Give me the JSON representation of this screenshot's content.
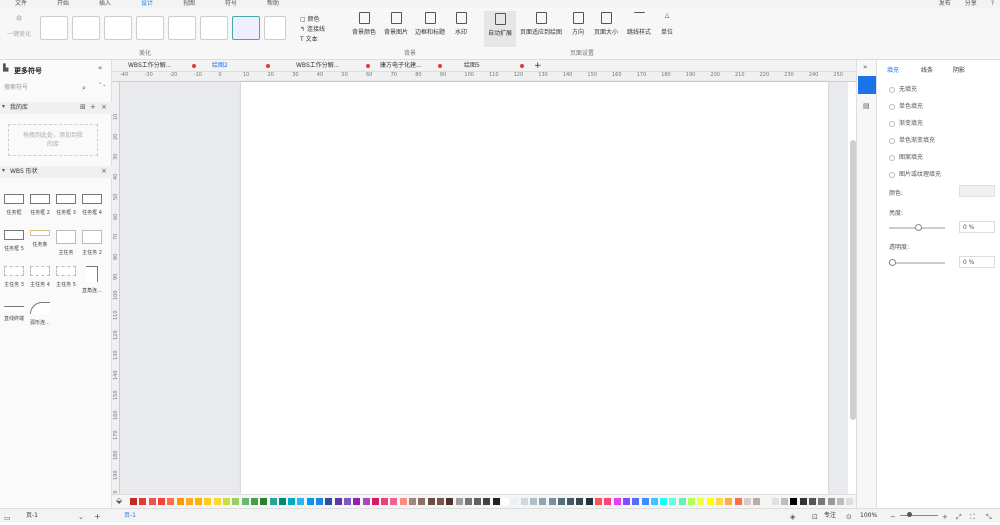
{
  "menu": {
    "tabs": [
      "文件",
      "开始",
      "插入",
      "设计",
      "视图",
      "符号",
      "帮助"
    ],
    "active_index": 3,
    "right": [
      "发布",
      "分享",
      "?"
    ]
  },
  "ribbon": {
    "beautify_label": "一键美化",
    "group_beautify": "美化",
    "theme_options": [
      "颜色",
      "连接线",
      "文本"
    ],
    "group_background": "背景",
    "bg_buttons": [
      "背景颜色",
      "背景图片",
      "边框和标题",
      "水印"
    ],
    "group_page": "页面设置",
    "page_buttons": [
      "自动扩展",
      "页面适应到绘图",
      "方向",
      "页面大小",
      "跳线样式",
      "单位"
    ]
  },
  "left_panel": {
    "title": "更多符号",
    "search_placeholder": "搜索符号",
    "my_library": "我的库",
    "drop_hint": "拖拽到此处，添加到我的库",
    "wbs_section": "WBS 形状",
    "shapes": [
      "任务框",
      "任务框 2",
      "任务框 3",
      "任务框 4",
      "任务框 5",
      "任务条",
      "主任务",
      "主任务 2",
      "主任务 3",
      "主任务 4",
      "主任务 5",
      "直角连…",
      "直线终端",
      "弧形连…"
    ]
  },
  "doc_tabs": [
    "WBS工作分解...",
    "绘图2",
    "WBS工作分解...",
    "康方电子化建...",
    "绘图5"
  ],
  "active_doc_tab": 1,
  "ruler_top": [
    "-40",
    "-30",
    "-20",
    "-10",
    "0",
    "10",
    "20",
    "30",
    "40",
    "50",
    "60",
    "70",
    "80",
    "90",
    "100",
    "110",
    "120",
    "130",
    "140",
    "150",
    "160",
    "170",
    "180",
    "190",
    "200",
    "210",
    "220",
    "230",
    "240",
    "250"
  ],
  "ruler_left": [
    "10",
    "20",
    "30",
    "40",
    "50",
    "60",
    "70",
    "80",
    "90",
    "100",
    "110",
    "120",
    "130",
    "140",
    "150",
    "160",
    "170",
    "180",
    "190",
    "200"
  ],
  "right_panel": {
    "tabs": [
      "填充",
      "线条",
      "阴影"
    ],
    "active_tab": 0,
    "fill_options": [
      "无填充",
      "单色填充",
      "渐变填充",
      "单色渐变填充",
      "图案填充",
      "图片或纹理填充"
    ],
    "color_label": "颜色:",
    "brightness_label": "亮度:",
    "brightness_value": "0 %",
    "transparency_label": "透明度:",
    "transparency_value": "0 %"
  },
  "status": {
    "page_left": "页-1",
    "page_tab": "页-1",
    "focus": "专注",
    "zoom": "100%"
  },
  "colors": {
    "accent": "#1a73e8",
    "red_dot": "#e53935"
  },
  "palette": [
    "#c62828",
    "#e53935",
    "#ef5350",
    "#f44336",
    "#ff7043",
    "#ff9800",
    "#ffa726",
    "#ffb300",
    "#ffca28",
    "#fdd835",
    "#cddc39",
    "#9ccc65",
    "#66bb6a",
    "#43a047",
    "#2e7d32",
    "#26a69a",
    "#00897b",
    "#00acc1",
    "#29b6f6",
    "#039be5",
    "#1e88e5",
    "#3949ab",
    "#5e35b1",
    "#7e57c2",
    "#8e24aa",
    "#ab47bc",
    "#d81b60",
    "#ec407a",
    "#f06292",
    "#ff8a80",
    "#a1887f",
    "#8d6e63",
    "#6d4c41",
    "#795548",
    "#4e342e",
    "#9e9e9e",
    "#757575",
    "#616161",
    "#424242",
    "#212121",
    "#ffffff",
    "#eceff1",
    "#cfd8dc",
    "#b0bec5",
    "#90a4ae",
    "#78909c",
    "#546e7a",
    "#455a64",
    "#37474f",
    "#263238",
    "#ff5252",
    "#ff4081",
    "#e040fb",
    "#7c4dff",
    "#536dfe",
    "#448aff",
    "#40c4ff",
    "#18ffff",
    "#64ffda",
    "#69f0ae",
    "#b2ff59",
    "#eeff41",
    "#ffff00",
    "#ffd740",
    "#ffab40",
    "#ff6e40",
    "#d7ccc8",
    "#bcaaa4",
    "#f5f5f5",
    "#e0e0e0",
    "#bdbdbd",
    "#000000",
    "#333333",
    "#555555",
    "#777777",
    "#999999",
    "#bbbbbb",
    "#dddddd",
    "#eeeeee",
    "#fafafa"
  ]
}
